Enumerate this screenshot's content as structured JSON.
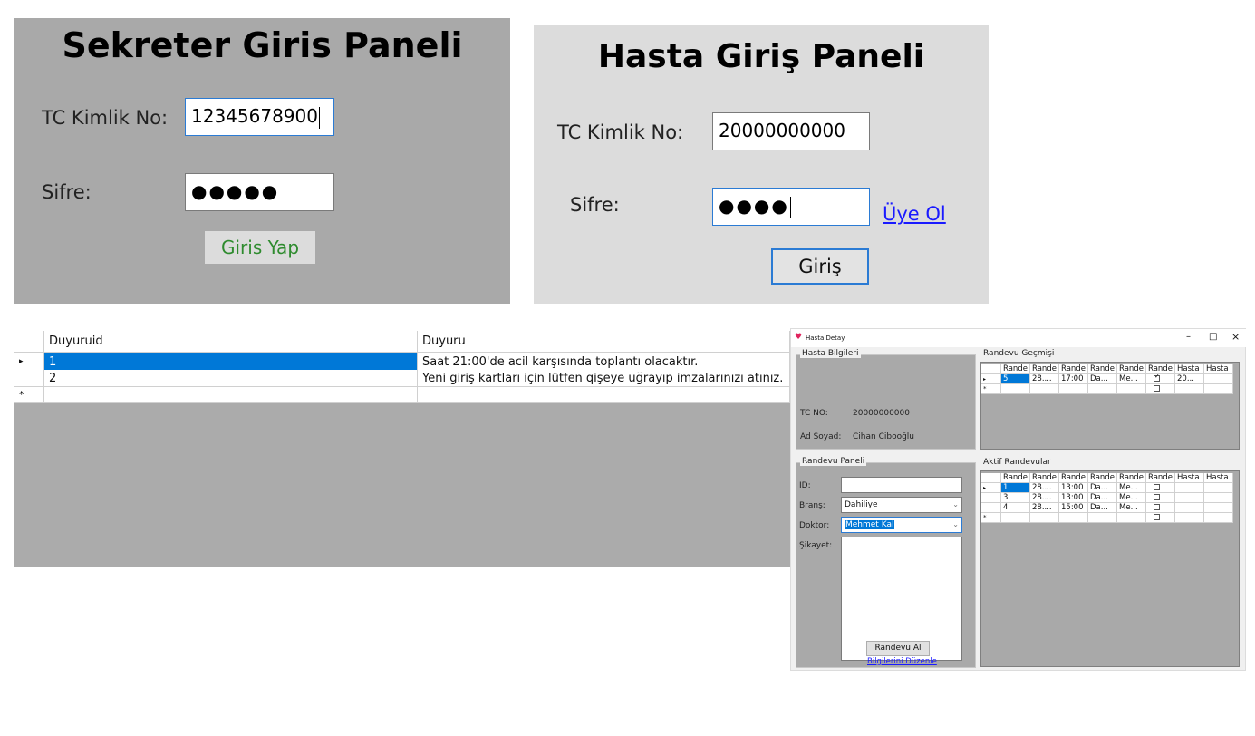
{
  "sekreter": {
    "title": "Sekreter Giris Paneli",
    "tc_label": "TC Kimlik No:",
    "tc_value": "12345678900",
    "sifre_label": "Sifre:",
    "sifre_mask": "●●●●●",
    "button": "Giris Yap"
  },
  "hasta_giris": {
    "title": "Hasta Giriş Paneli",
    "tc_label": "TC Kimlik No:",
    "tc_value": "20000000000",
    "sifre_label": "Sifre:",
    "sifre_mask": "●●●●",
    "uye_link": "Üye Ol",
    "button": "Giriş"
  },
  "duyuru_grid": {
    "columns": [
      "Duyuruid",
      "Duyuru"
    ],
    "rows": [
      [
        "1",
        "Saat 21:00'de acil karşısında toplantı olacaktır."
      ],
      [
        "2",
        "Yeni giriş kartları için lütfen qişeye uğrayıp imzalarınızı atınız."
      ]
    ],
    "current_row_marker": "▸",
    "new_row_marker": "*"
  },
  "hasta_detay": {
    "window_title": "Hasta Detay",
    "controls": {
      "minimize": "–",
      "maximize": "□",
      "close": "×"
    },
    "hasta_bilgileri": {
      "group": "Hasta Bilgileri",
      "tc_label": "TC NO:",
      "tc_value": "20000000000",
      "ad_label": "Ad Soyad:",
      "ad_value": "Cihan Ciboоğlu"
    },
    "randevu_gecmisi": {
      "group": "Randevu Geçmişi",
      "columns": [
        "Rande",
        "Rande",
        "Rande",
        "Rande",
        "Rande",
        "Rande",
        "Hasta",
        "Hasta"
      ],
      "rows": [
        [
          "5",
          "28....",
          "17:00",
          "Da...",
          "Me...",
          "checked",
          "20...",
          ""
        ]
      ]
    },
    "randevu_paneli": {
      "group": "Randevu Paneli",
      "id_label": "ID:",
      "id_value": "",
      "brans_label": "Branş:",
      "brans_value": "Dahiliye",
      "doktor_label": "Doktor:",
      "doktor_value": "Mehmet Kal",
      "sikayet_label": "Şikayet:",
      "button": "Randevu Al",
      "link": "Bilgilerini Düzenle"
    },
    "aktif_randevular": {
      "group": "Aktif Randevular",
      "columns": [
        "Rande",
        "Rande",
        "Rande",
        "Rande",
        "Rande",
        "Rande",
        "Hasta",
        "Hasta"
      ],
      "rows": [
        [
          "1",
          "28....",
          "13:00",
          "Da...",
          "Me...",
          "unchecked",
          "",
          ""
        ],
        [
          "3",
          "28....",
          "13:00",
          "Da...",
          "Me...",
          "unchecked",
          "",
          ""
        ],
        [
          "4",
          "28....",
          "15:00",
          "Da...",
          "Me...",
          "unchecked",
          "",
          ""
        ]
      ]
    }
  },
  "colors": {
    "selection": "#0078d7",
    "panel_gray": "#a9a9a9",
    "login_green": "#2e8b2e",
    "link_blue": "#1a1aff",
    "focus_blue": "#2b7bd4"
  }
}
